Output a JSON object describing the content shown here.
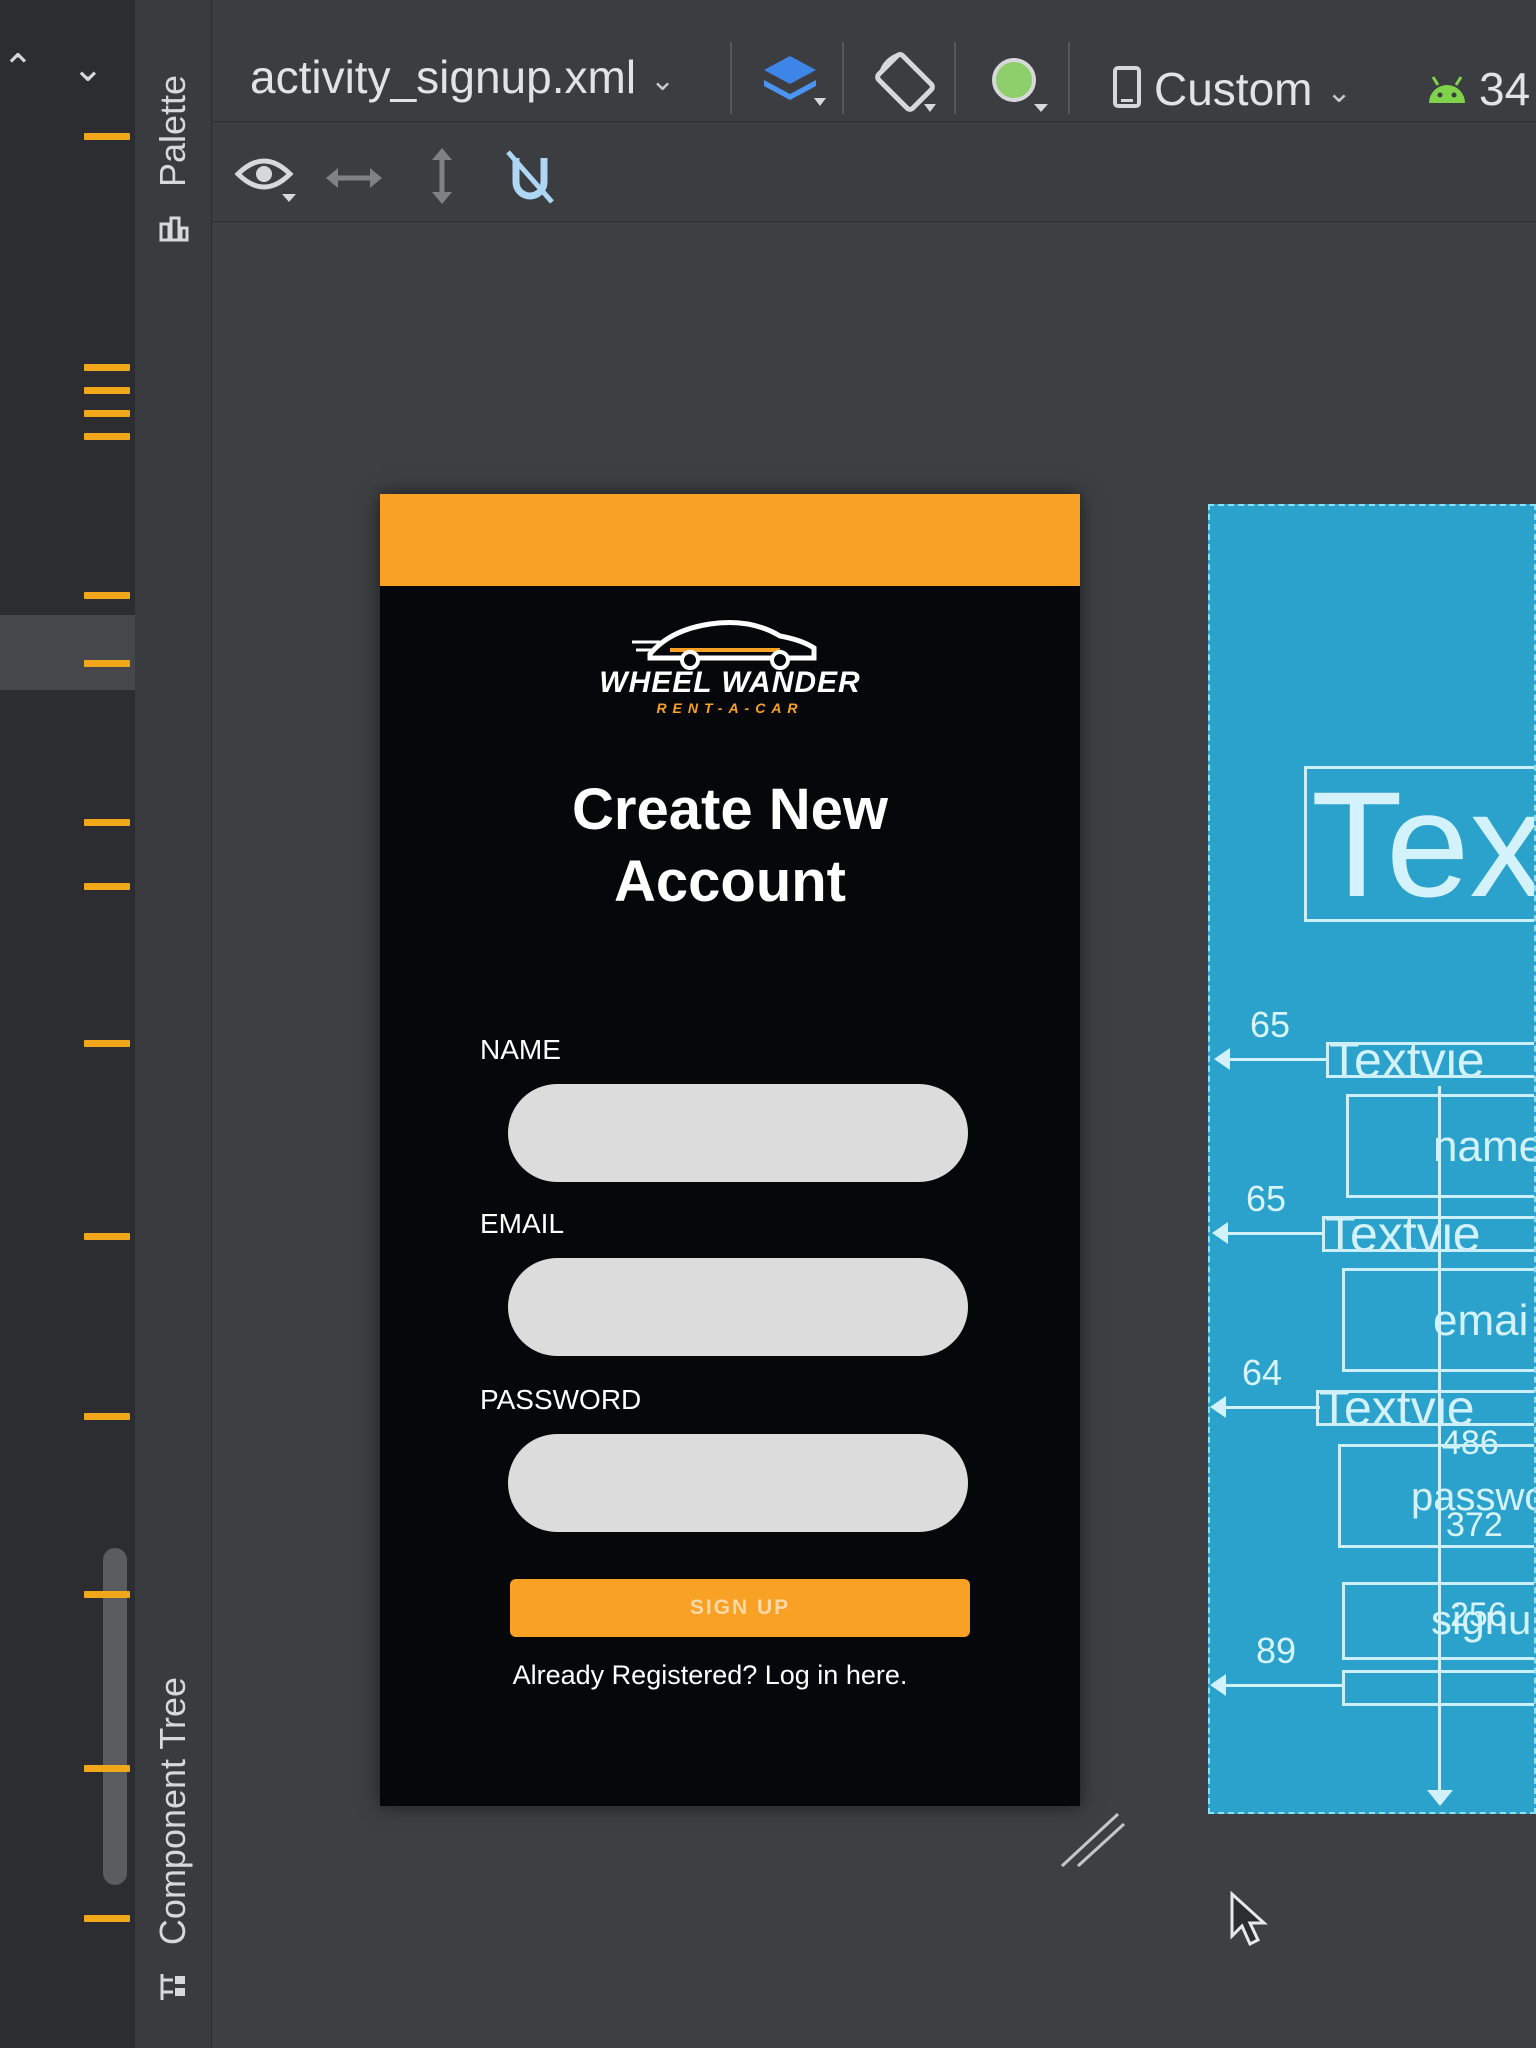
{
  "toolbar": {
    "file_tab": "activity_signup.xml",
    "device": "Custom",
    "api_level": "34"
  },
  "sidebar": {
    "palette_label": "Palette",
    "component_tree_label": "Component Tree"
  },
  "preview": {
    "logo_title": "WHEEL WANDER",
    "logo_subtitle": "RENT-A-CAR",
    "title_line1": "Create New",
    "title_line2": "Account",
    "name_label": "NAME",
    "email_label": "EMAIL",
    "password_label": "PASSWORD",
    "signup_button": "SIGN UP",
    "login_link": "Already Registered? Log in here."
  },
  "blueprint": {
    "title_text": "Tex",
    "view1": "Textvie",
    "name_box": "name",
    "view2": "Textvie",
    "email_box": "emai",
    "view3": "Textvie",
    "password_box": "passwo",
    "signup_box": "signu",
    "dims": {
      "a": "65",
      "b": "65",
      "c": "64",
      "d": "486",
      "e": "372",
      "f": "256",
      "g": "89"
    }
  },
  "colors": {
    "accent_orange": "#f8a124",
    "ide_background": "#3d3f42",
    "blueprint_blue": "#2aa2cc",
    "phone_background": "#06070a"
  }
}
